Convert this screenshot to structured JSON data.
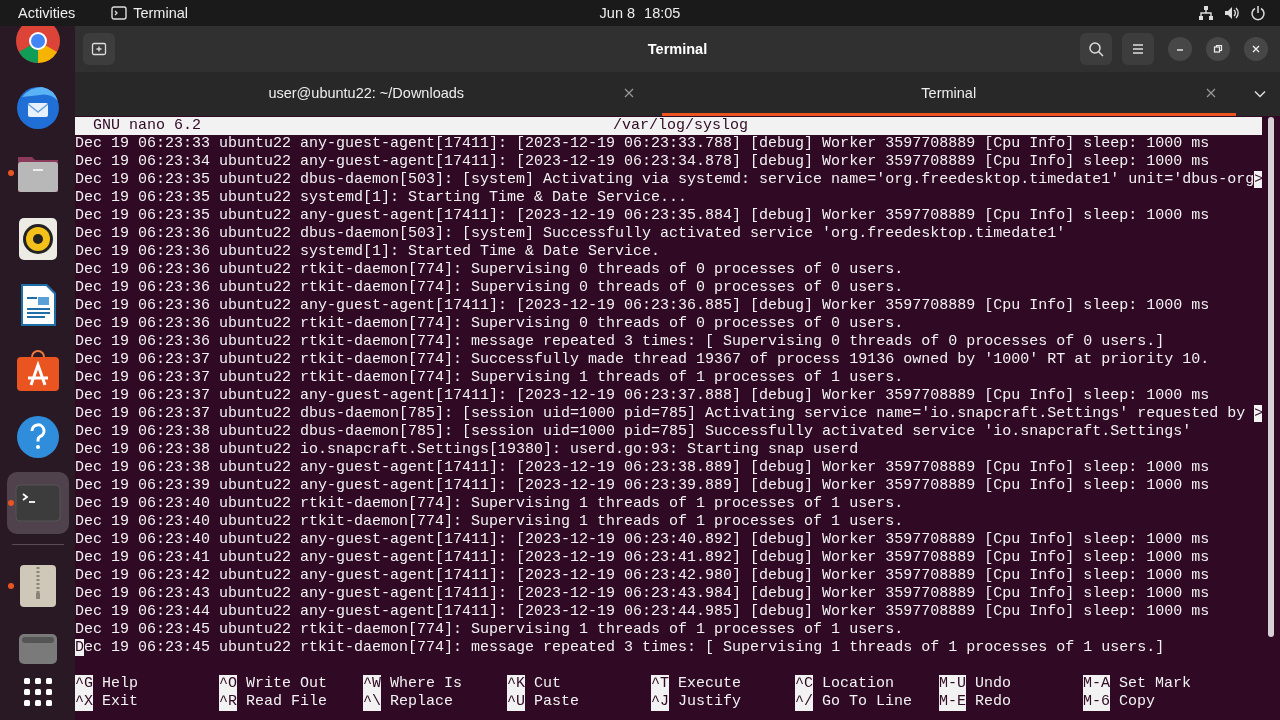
{
  "topbar": {
    "activities": "Activities",
    "app": "Terminal",
    "date": "Jun 8",
    "time": "18:05"
  },
  "dock": [
    {
      "kind": "chrome",
      "running": false,
      "selected": false
    },
    {
      "kind": "thunderbird",
      "running": false,
      "selected": false
    },
    {
      "kind": "files",
      "running": true,
      "selected": false
    },
    {
      "kind": "rhythmbox",
      "running": false,
      "selected": false
    },
    {
      "kind": "writer",
      "running": false,
      "selected": false
    },
    {
      "kind": "software",
      "running": false,
      "selected": false
    },
    {
      "kind": "help",
      "running": false,
      "selected": false
    },
    {
      "kind": "terminal",
      "running": true,
      "selected": true
    },
    {
      "kind": "separator"
    },
    {
      "kind": "archive",
      "running": true,
      "selected": false
    },
    {
      "kind": "drive",
      "running": false,
      "selected": false
    }
  ],
  "window": {
    "title": "Terminal"
  },
  "tabs": [
    {
      "label": "user@ubuntu22: ~/Downloads",
      "selected": false
    },
    {
      "label": "Terminal",
      "selected": true
    }
  ],
  "nano": {
    "version": "GNU nano 6.2",
    "file": "/var/log/syslog",
    "lines": [
      {
        "text": "Dec 19 06:23:33 ubuntu22 any-guest-agent[17411]: [2023-12-19 06:23:33.788] [debug] Worker 3597708889 [Cpu Info] sleep: 1000 ms"
      },
      {
        "text": "Dec 19 06:23:34 ubuntu22 any-guest-agent[17411]: [2023-12-19 06:23:34.878] [debug] Worker 3597708889 [Cpu Info] sleep: 1000 ms"
      },
      {
        "text": "Dec 19 06:23:35 ubuntu22 dbus-daemon[503]: [system] Activating via systemd: service name='org.freedesktop.timedate1' unit='dbus-org",
        "overflow": ">"
      },
      {
        "text": "Dec 19 06:23:35 ubuntu22 systemd[1]: Starting Time & Date Service..."
      },
      {
        "text": "Dec 19 06:23:35 ubuntu22 any-guest-agent[17411]: [2023-12-19 06:23:35.884] [debug] Worker 3597708889 [Cpu Info] sleep: 1000 ms"
      },
      {
        "text": "Dec 19 06:23:36 ubuntu22 dbus-daemon[503]: [system] Successfully activated service 'org.freedesktop.timedate1'"
      },
      {
        "text": "Dec 19 06:23:36 ubuntu22 systemd[1]: Started Time & Date Service."
      },
      {
        "text": "Dec 19 06:23:36 ubuntu22 rtkit-daemon[774]: Supervising 0 threads of 0 processes of 0 users."
      },
      {
        "text": "Dec 19 06:23:36 ubuntu22 rtkit-daemon[774]: Supervising 0 threads of 0 processes of 0 users."
      },
      {
        "text": "Dec 19 06:23:36 ubuntu22 any-guest-agent[17411]: [2023-12-19 06:23:36.885] [debug] Worker 3597708889 [Cpu Info] sleep: 1000 ms"
      },
      {
        "text": "Dec 19 06:23:36 ubuntu22 rtkit-daemon[774]: Supervising 0 threads of 0 processes of 0 users."
      },
      {
        "text": "Dec 19 06:23:36 ubuntu22 rtkit-daemon[774]: message repeated 3 times: [ Supervising 0 threads of 0 processes of 0 users.]"
      },
      {
        "text": "Dec 19 06:23:37 ubuntu22 rtkit-daemon[774]: Successfully made thread 19367 of process 19136 owned by '1000' RT at priority 10."
      },
      {
        "text": "Dec 19 06:23:37 ubuntu22 rtkit-daemon[774]: Supervising 1 threads of 1 processes of 1 users."
      },
      {
        "text": "Dec 19 06:23:37 ubuntu22 any-guest-agent[17411]: [2023-12-19 06:23:37.888] [debug] Worker 3597708889 [Cpu Info] sleep: 1000 ms"
      },
      {
        "text": "Dec 19 06:23:37 ubuntu22 dbus-daemon[785]: [session uid=1000 pid=785] Activating service name='io.snapcraft.Settings' requested by ",
        "overflow": ">"
      },
      {
        "text": "Dec 19 06:23:38 ubuntu22 dbus-daemon[785]: [session uid=1000 pid=785] Successfully activated service 'io.snapcraft.Settings'"
      },
      {
        "text": "Dec 19 06:23:38 ubuntu22 io.snapcraft.Settings[19380]: userd.go:93: Starting snap userd"
      },
      {
        "text": "Dec 19 06:23:38 ubuntu22 any-guest-agent[17411]: [2023-12-19 06:23:38.889] [debug] Worker 3597708889 [Cpu Info] sleep: 1000 ms"
      },
      {
        "text": "Dec 19 06:23:39 ubuntu22 any-guest-agent[17411]: [2023-12-19 06:23:39.889] [debug] Worker 3597708889 [Cpu Info] sleep: 1000 ms"
      },
      {
        "text": "Dec 19 06:23:40 ubuntu22 rtkit-daemon[774]: Supervising 1 threads of 1 processes of 1 users."
      },
      {
        "text": "Dec 19 06:23:40 ubuntu22 rtkit-daemon[774]: Supervising 1 threads of 1 processes of 1 users."
      },
      {
        "text": "Dec 19 06:23:40 ubuntu22 any-guest-agent[17411]: [2023-12-19 06:23:40.892] [debug] Worker 3597708889 [Cpu Info] sleep: 1000 ms"
      },
      {
        "text": "Dec 19 06:23:41 ubuntu22 any-guest-agent[17411]: [2023-12-19 06:23:41.892] [debug] Worker 3597708889 [Cpu Info] sleep: 1000 ms"
      },
      {
        "text": "Dec 19 06:23:42 ubuntu22 any-guest-agent[17411]: [2023-12-19 06:23:42.980] [debug] Worker 3597708889 [Cpu Info] sleep: 1000 ms"
      },
      {
        "text": "Dec 19 06:23:43 ubuntu22 any-guest-agent[17411]: [2023-12-19 06:23:43.984] [debug] Worker 3597708889 [Cpu Info] sleep: 1000 ms"
      },
      {
        "text": "Dec 19 06:23:44 ubuntu22 any-guest-agent[17411]: [2023-12-19 06:23:44.985] [debug] Worker 3597708889 [Cpu Info] sleep: 1000 ms"
      },
      {
        "text": "Dec 19 06:23:45 ubuntu22 rtkit-daemon[774]: Supervising 1 threads of 1 processes of 1 users."
      },
      {
        "text": "Dec 19 06:23:45 ubuntu22 rtkit-daemon[774]: message repeated 3 times: [ Supervising 1 threads of 1 processes of 1 users.]",
        "cursor": true
      }
    ],
    "shortcuts": [
      {
        "key": "^G",
        "label": "Help"
      },
      {
        "key": "^O",
        "label": "Write Out"
      },
      {
        "key": "^W",
        "label": "Where Is"
      },
      {
        "key": "^K",
        "label": "Cut"
      },
      {
        "key": "^T",
        "label": "Execute"
      },
      {
        "key": "^C",
        "label": "Location"
      },
      {
        "key": "M-U",
        "label": "Undo"
      },
      {
        "key": "M-A",
        "label": "Set Mark"
      },
      {
        "key": "^X",
        "label": "Exit"
      },
      {
        "key": "^R",
        "label": "Read File"
      },
      {
        "key": "^\\",
        "label": "Replace"
      },
      {
        "key": "^U",
        "label": "Paste"
      },
      {
        "key": "^J",
        "label": "Justify"
      },
      {
        "key": "^/",
        "label": "Go To Line"
      },
      {
        "key": "M-E",
        "label": "Redo"
      },
      {
        "key": "M-6",
        "label": "Copy"
      }
    ]
  }
}
